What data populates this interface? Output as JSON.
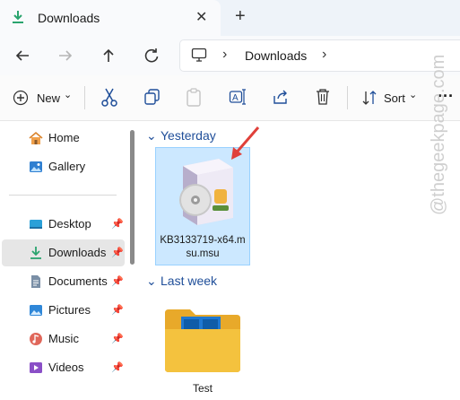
{
  "tab": {
    "title": "Downloads",
    "close_glyph": "✕",
    "new_glyph": "+"
  },
  "nav": {
    "back_glyph": "←",
    "forward_glyph": "→",
    "up_glyph": "↑",
    "refresh_glyph": "↻"
  },
  "address": {
    "separator": "›",
    "crumb": "Downloads",
    "end_separator": "›"
  },
  "toolbar": {
    "new_label": "New",
    "new_chevron": "⌄",
    "sort_label": "Sort",
    "sort_chevron": "⌄",
    "more_glyph": "···"
  },
  "sidebar": {
    "items": [
      {
        "label": "Home",
        "icon": "home-icon"
      },
      {
        "label": "Gallery",
        "icon": "gallery-icon"
      },
      {
        "label": "Desktop",
        "icon": "desktop-icon",
        "pinned": true
      },
      {
        "label": "Downloads",
        "icon": "download-icon",
        "pinned": true
      },
      {
        "label": "Documents",
        "icon": "documents-icon",
        "pinned": true
      },
      {
        "label": "Pictures",
        "icon": "pictures-icon",
        "pinned": true
      },
      {
        "label": "Music",
        "icon": "music-icon",
        "pinned": true
      },
      {
        "label": "Videos",
        "icon": "videos-icon",
        "pinned": true
      }
    ]
  },
  "groups": [
    {
      "label": "Yesterday",
      "chevron": "⌄"
    },
    {
      "label": "Last week",
      "chevron": "⌄"
    }
  ],
  "files": [
    {
      "name_line1": "KB3133719-x64.m",
      "name_line2": "su.msu"
    },
    {
      "name": "Test"
    }
  ],
  "watermark": "@thegeekpage.com",
  "colors": {
    "accent": "#1f4e99",
    "selection": "#cce8ff",
    "arrow": "#e0403a",
    "download_green": "#2aa46e",
    "folder_yellow": "#f4c23e",
    "folder_blue": "#1f78d1"
  }
}
